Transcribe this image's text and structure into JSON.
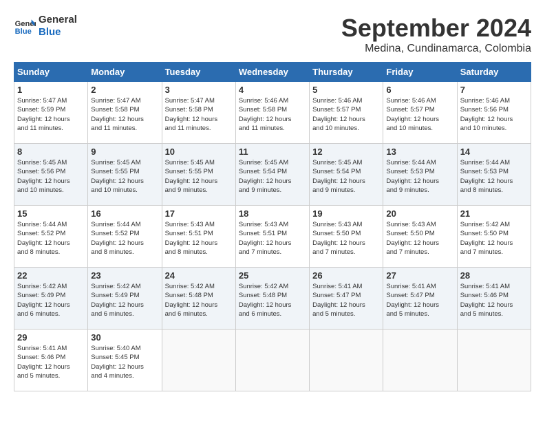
{
  "logo": {
    "line1": "General",
    "line2": "Blue"
  },
  "title": "September 2024",
  "location": "Medina, Cundinamarca, Colombia",
  "days_of_week": [
    "Sunday",
    "Monday",
    "Tuesday",
    "Wednesday",
    "Thursday",
    "Friday",
    "Saturday"
  ],
  "weeks": [
    [
      {
        "day": "1",
        "info": "Sunrise: 5:47 AM\nSunset: 5:59 PM\nDaylight: 12 hours\nand 11 minutes."
      },
      {
        "day": "2",
        "info": "Sunrise: 5:47 AM\nSunset: 5:58 PM\nDaylight: 12 hours\nand 11 minutes."
      },
      {
        "day": "3",
        "info": "Sunrise: 5:47 AM\nSunset: 5:58 PM\nDaylight: 12 hours\nand 11 minutes."
      },
      {
        "day": "4",
        "info": "Sunrise: 5:46 AM\nSunset: 5:58 PM\nDaylight: 12 hours\nand 11 minutes."
      },
      {
        "day": "5",
        "info": "Sunrise: 5:46 AM\nSunset: 5:57 PM\nDaylight: 12 hours\nand 10 minutes."
      },
      {
        "day": "6",
        "info": "Sunrise: 5:46 AM\nSunset: 5:57 PM\nDaylight: 12 hours\nand 10 minutes."
      },
      {
        "day": "7",
        "info": "Sunrise: 5:46 AM\nSunset: 5:56 PM\nDaylight: 12 hours\nand 10 minutes."
      }
    ],
    [
      {
        "day": "8",
        "info": "Sunrise: 5:45 AM\nSunset: 5:56 PM\nDaylight: 12 hours\nand 10 minutes."
      },
      {
        "day": "9",
        "info": "Sunrise: 5:45 AM\nSunset: 5:55 PM\nDaylight: 12 hours\nand 10 minutes."
      },
      {
        "day": "10",
        "info": "Sunrise: 5:45 AM\nSunset: 5:55 PM\nDaylight: 12 hours\nand 9 minutes."
      },
      {
        "day": "11",
        "info": "Sunrise: 5:45 AM\nSunset: 5:54 PM\nDaylight: 12 hours\nand 9 minutes."
      },
      {
        "day": "12",
        "info": "Sunrise: 5:45 AM\nSunset: 5:54 PM\nDaylight: 12 hours\nand 9 minutes."
      },
      {
        "day": "13",
        "info": "Sunrise: 5:44 AM\nSunset: 5:53 PM\nDaylight: 12 hours\nand 9 minutes."
      },
      {
        "day": "14",
        "info": "Sunrise: 5:44 AM\nSunset: 5:53 PM\nDaylight: 12 hours\nand 8 minutes."
      }
    ],
    [
      {
        "day": "15",
        "info": "Sunrise: 5:44 AM\nSunset: 5:52 PM\nDaylight: 12 hours\nand 8 minutes."
      },
      {
        "day": "16",
        "info": "Sunrise: 5:44 AM\nSunset: 5:52 PM\nDaylight: 12 hours\nand 8 minutes."
      },
      {
        "day": "17",
        "info": "Sunrise: 5:43 AM\nSunset: 5:51 PM\nDaylight: 12 hours\nand 8 minutes."
      },
      {
        "day": "18",
        "info": "Sunrise: 5:43 AM\nSunset: 5:51 PM\nDaylight: 12 hours\nand 7 minutes."
      },
      {
        "day": "19",
        "info": "Sunrise: 5:43 AM\nSunset: 5:50 PM\nDaylight: 12 hours\nand 7 minutes."
      },
      {
        "day": "20",
        "info": "Sunrise: 5:43 AM\nSunset: 5:50 PM\nDaylight: 12 hours\nand 7 minutes."
      },
      {
        "day": "21",
        "info": "Sunrise: 5:42 AM\nSunset: 5:50 PM\nDaylight: 12 hours\nand 7 minutes."
      }
    ],
    [
      {
        "day": "22",
        "info": "Sunrise: 5:42 AM\nSunset: 5:49 PM\nDaylight: 12 hours\nand 6 minutes."
      },
      {
        "day": "23",
        "info": "Sunrise: 5:42 AM\nSunset: 5:49 PM\nDaylight: 12 hours\nand 6 minutes."
      },
      {
        "day": "24",
        "info": "Sunrise: 5:42 AM\nSunset: 5:48 PM\nDaylight: 12 hours\nand 6 minutes."
      },
      {
        "day": "25",
        "info": "Sunrise: 5:42 AM\nSunset: 5:48 PM\nDaylight: 12 hours\nand 6 minutes."
      },
      {
        "day": "26",
        "info": "Sunrise: 5:41 AM\nSunset: 5:47 PM\nDaylight: 12 hours\nand 5 minutes."
      },
      {
        "day": "27",
        "info": "Sunrise: 5:41 AM\nSunset: 5:47 PM\nDaylight: 12 hours\nand 5 minutes."
      },
      {
        "day": "28",
        "info": "Sunrise: 5:41 AM\nSunset: 5:46 PM\nDaylight: 12 hours\nand 5 minutes."
      }
    ],
    [
      {
        "day": "29",
        "info": "Sunrise: 5:41 AM\nSunset: 5:46 PM\nDaylight: 12 hours\nand 5 minutes."
      },
      {
        "day": "30",
        "info": "Sunrise: 5:40 AM\nSunset: 5:45 PM\nDaylight: 12 hours\nand 4 minutes."
      },
      {
        "day": "",
        "info": ""
      },
      {
        "day": "",
        "info": ""
      },
      {
        "day": "",
        "info": ""
      },
      {
        "day": "",
        "info": ""
      },
      {
        "day": "",
        "info": ""
      }
    ]
  ]
}
